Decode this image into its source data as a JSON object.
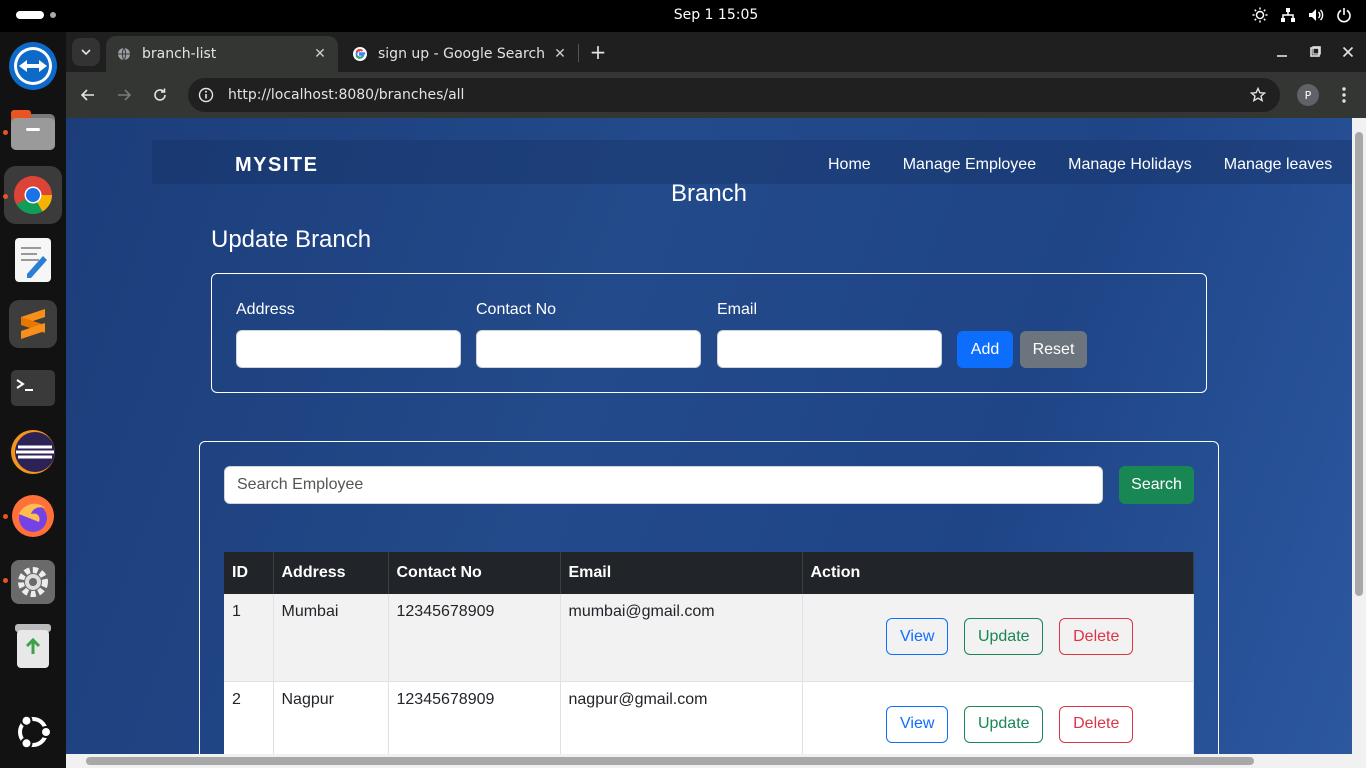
{
  "system": {
    "clock": "Sep 1  15:05",
    "tray_icons": [
      "brightness-icon",
      "network-icon",
      "volume-icon",
      "power-icon"
    ]
  },
  "dock": {
    "apps": [
      "teamviewer-icon",
      "files-icon",
      "chrome-icon",
      "text-editor-icon",
      "sublime-icon",
      "terminal-icon",
      "eclipse-icon",
      "firefox-icon",
      "settings-icon",
      "trash-icon",
      "ubuntu-icon"
    ]
  },
  "browser": {
    "tabs": [
      {
        "title": "branch-list",
        "active": true
      },
      {
        "title": "sign up - Google Search",
        "active": false
      }
    ],
    "url": "http://localhost:8080/branches/all",
    "profile_initial": "P"
  },
  "site": {
    "brand": "MYSITE",
    "nav": [
      "Home",
      "Manage Employee",
      "Manage Holidays",
      "Manage leaves"
    ],
    "heading": "Branch",
    "form_title": "Update Branch",
    "form": {
      "address_label": "Address",
      "contact_label": "Contact No",
      "email_label": "Email",
      "address_value": "",
      "contact_value": "",
      "email_value": "",
      "add_label": "Add",
      "reset_label": "Reset"
    },
    "search": {
      "placeholder": "Search Employee",
      "button_label": "Search"
    },
    "table": {
      "headers": [
        "ID",
        "Address",
        "Contact No",
        "Email",
        "Action"
      ],
      "rows": [
        {
          "id": "1",
          "address": "Mumbai",
          "contact": "12345678909",
          "email": "mumbai@gmail.com"
        },
        {
          "id": "2",
          "address": "Nagpur",
          "contact": "12345678909",
          "email": "nagpur@gmail.com"
        }
      ],
      "actions": {
        "view": "View",
        "update": "Update",
        "delete": "Delete"
      }
    }
  },
  "colors": {
    "primary": "#0d6efd",
    "secondary": "#6c757d",
    "success": "#198754",
    "danger": "#dc3545",
    "page_bg": "#234a8a",
    "accent_dot": "#e95420"
  }
}
